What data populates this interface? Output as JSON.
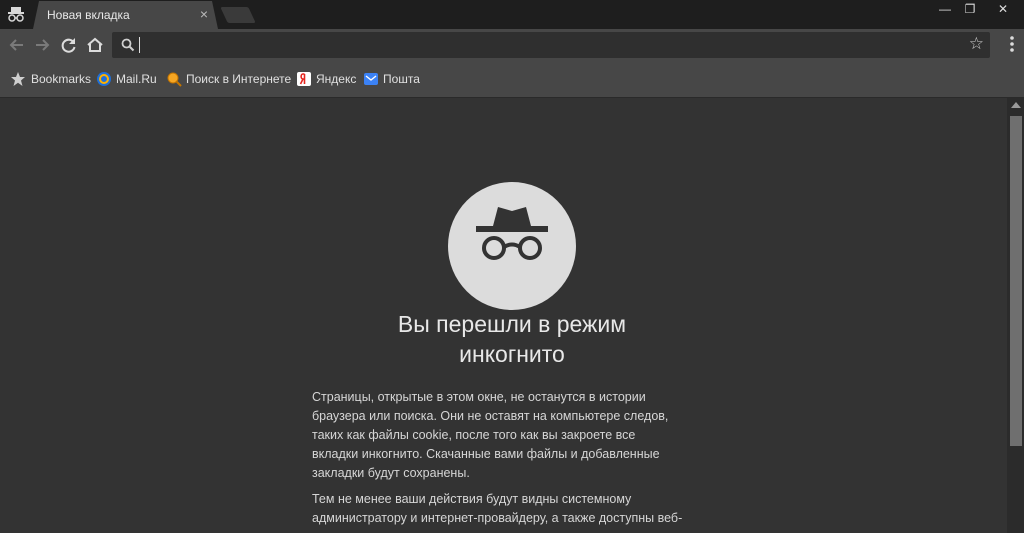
{
  "window": {
    "tab_title": "Новая вкладка",
    "tab_close": "×",
    "minimize": "—",
    "restore": "❐",
    "close": "✕"
  },
  "toolbar": {
    "back_icon": "arrow-left-icon",
    "forward_icon": "arrow-right-icon",
    "reload_icon": "reload-icon",
    "home_icon": "home-icon",
    "omnibox_value": "",
    "star": "☆"
  },
  "bookmarks": [
    {
      "label": "Bookmarks",
      "icon": "star-icon"
    },
    {
      "label": "Mail.Ru",
      "icon": "mailru-icon"
    },
    {
      "label": "Поиск в Интернете",
      "icon": "search-globe-icon"
    },
    {
      "label": "Яндекс",
      "icon": "yandex-icon"
    },
    {
      "label": "Пошта",
      "icon": "mail-icon"
    }
  ],
  "content": {
    "heading_line1": "Вы перешли в режим",
    "heading_line2": "инкогнито",
    "para1": [
      "Страницы, открытые в этом окне, не останутся в истории",
      "браузера или поиска. Они не оставят на компьютере следов,",
      "таких как файлы cookie, после того как вы закроете все",
      "вкладки инкогнито. Скачанные вами файлы и добавленные",
      "закладки будут сохранены."
    ],
    "para2": [
      "Тем не менее ваши действия будут видны системному",
      "администратору и интернет-провайдеру, а также доступны веб-"
    ]
  },
  "colors": {
    "background": "#333333",
    "chrome": "#474747",
    "titlebar": "#1e1e1e",
    "hero_circle": "#dcdcdc"
  }
}
